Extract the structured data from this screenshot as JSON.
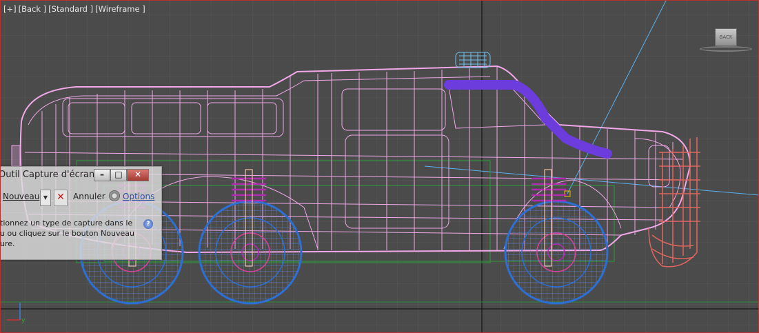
{
  "viewport": {
    "label_parts": [
      "[+]",
      "[Back ]",
      "[Standard ]",
      "[Wireframe ]"
    ],
    "viewcube_label": "BACK",
    "colors": {
      "background": "#4b4b4b",
      "grid": "#5a5a5a",
      "border_active": "#b8332b",
      "body_wire": "#f0a8e8",
      "wheel_wire": "#3f7fe0",
      "bumper_wire": "#e0665e",
      "snorkel_wire": "#6c3cdc",
      "spring_wire": "#b22ab2"
    }
  },
  "dialog": {
    "title": "Outil Capture d'écran",
    "new_label": "Nouveau",
    "cancel_label": "Annuler",
    "options_label": "Options",
    "message_line1": "tionnez un type de capture dans le",
    "message_line2": "u ou cliquez sur le bouton Nouveau",
    "message_line3": "ure.",
    "icons": {
      "minimize": "minimize-icon",
      "maximize": "maximize-icon",
      "close": "close-icon",
      "dropdown": "chevron-down-icon",
      "cancel": "cancel-x-icon",
      "options": "gear-icon",
      "help": "help-icon"
    }
  }
}
